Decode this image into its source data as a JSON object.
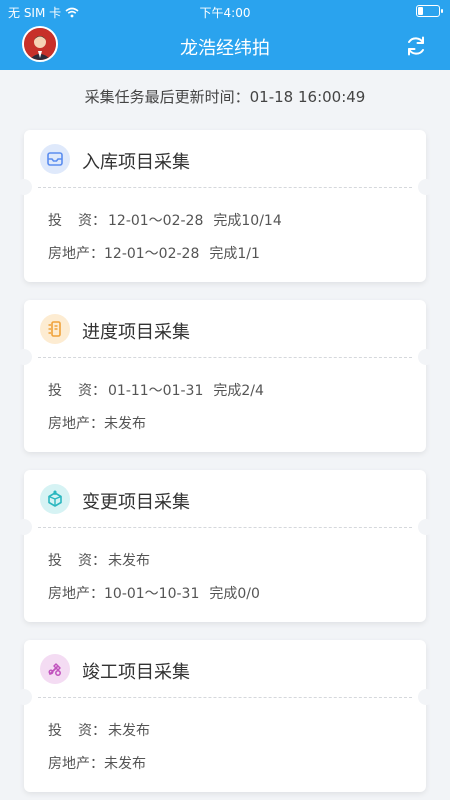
{
  "status_bar": {
    "carrier": "无 SIM 卡",
    "time": "下午4:00"
  },
  "nav": {
    "title": "龙浩经纬拍"
  },
  "update": {
    "text": "采集任务最后更新时间：01-18 16:00:49"
  },
  "labels": {
    "invest_a": "投",
    "invest_b": "资：",
    "realestate": "房地产："
  },
  "cards": [
    {
      "title": "入库项目采集",
      "icon": "inbox-icon",
      "icon_bg": "#dfe9fb",
      "icon_color": "#5b8def",
      "invest_value": "12-01～02-28",
      "invest_status": "完成10/14",
      "realestate_value": "12-01～02-28",
      "realestate_status": "完成1/1"
    },
    {
      "title": "进度项目采集",
      "icon": "progress-icon",
      "icon_bg": "#fdecd2",
      "icon_color": "#f0a23a",
      "invest_value": "01-11～01-31",
      "invest_status": "完成2/4",
      "realestate_value": "未发布",
      "realestate_status": ""
    },
    {
      "title": "变更项目采集",
      "icon": "box-change-icon",
      "icon_bg": "#d6f3f4",
      "icon_color": "#2bb7bf",
      "invest_value": "未发布",
      "invest_status": "",
      "realestate_value": "10-01～10-31",
      "realestate_status": "完成0/0"
    },
    {
      "title": "竣工项目采集",
      "icon": "tools-icon",
      "icon_bg": "#f4dcf3",
      "icon_color": "#c052bd",
      "invest_value": "未发布",
      "invest_status": "",
      "realestate_value": "未发布",
      "realestate_status": ""
    }
  ]
}
